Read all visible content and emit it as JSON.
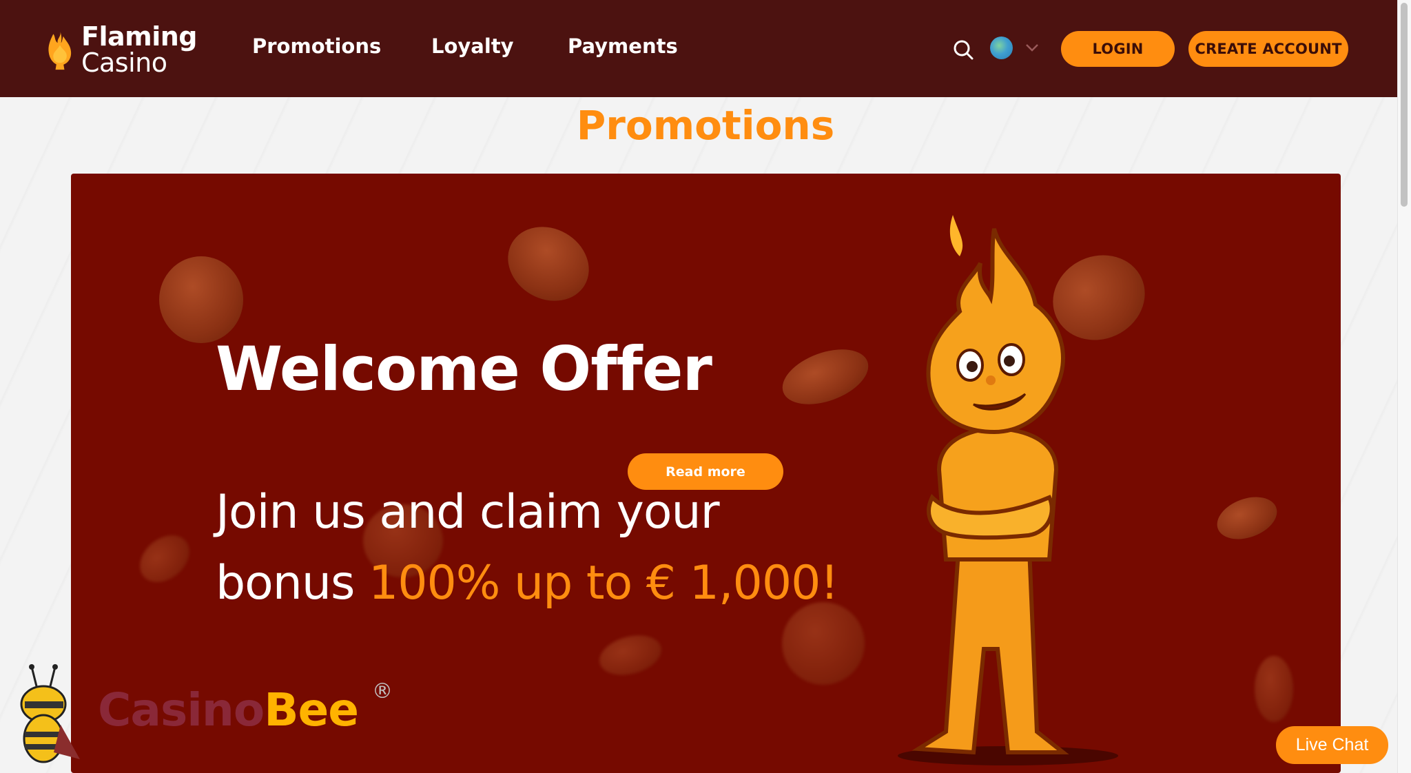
{
  "header": {
    "logo": {
      "line1": "Flaming",
      "line2": "Casino"
    },
    "nav": [
      {
        "label": "Promotions"
      },
      {
        "label": "Loyalty"
      },
      {
        "label": "Payments"
      }
    ],
    "icons": {
      "search": "search-icon",
      "language": "globe-icon",
      "dropdown": "chevron-down-icon"
    },
    "login_label": "LOGIN",
    "create_account_label": "CREATE ACCOUNT"
  },
  "page": {
    "title": "Promotions"
  },
  "banner": {
    "title": "Welcome Offer",
    "read_more_label": "Read more",
    "line1": "Join us and claim your",
    "line2_prefix": "bonus",
    "line2_highlight": "100% up to € 1,000!"
  },
  "watermark": {
    "part1": "Casino",
    "part2": "Bee",
    "registered": "®"
  },
  "live_chat_label": "Live Chat",
  "colors": {
    "header_bg": "#4c1210",
    "accent": "#ff8d10",
    "banner_bg": "#760a00"
  }
}
